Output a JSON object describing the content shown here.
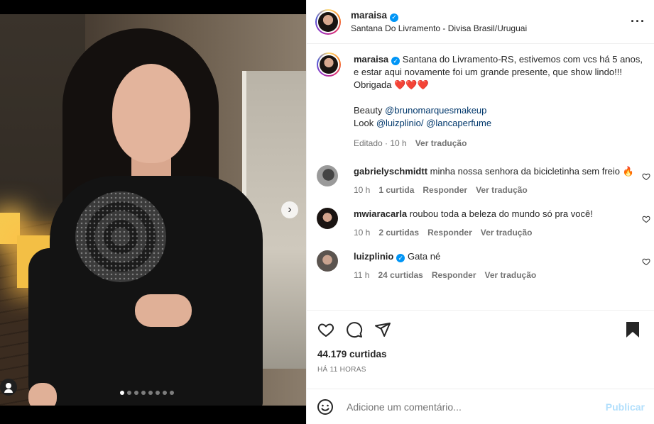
{
  "post": {
    "author": "maraisa",
    "location": "Santana Do Livramento - Divisa Brasil/Uruguai",
    "verified": true
  },
  "media": {
    "slide_count": 8,
    "active_slide": 1,
    "next_icon": "chevron-right-icon",
    "tag_icon": "person-tag-icon"
  },
  "caption": {
    "user": "maraisa",
    "text1": "Santana do Livramento-RS, estivemos com vcs há 5 anos, e estar aqui novamente foi um grande presente, que show lindo!!! Obrigada",
    "hearts": "❤️❤️❤️",
    "beauty_label": "Beauty",
    "beauty_handle": "@brunomarquesmakeup",
    "look_label": "Look",
    "look_handle1": "@luizplinio/",
    "look_handle2": "@lancaperfume",
    "edited": "Editado · 10 h",
    "translate": "Ver tradução"
  },
  "comments": [
    {
      "user": "gabrielyschmidtt",
      "text": "minha nossa senhora da bicicletinha sem freio",
      "emoji": "🔥",
      "time": "10 h",
      "likes": "1 curtida",
      "reply": "Responder",
      "translate": "Ver tradução"
    },
    {
      "user": "mwiaracarla",
      "text": "roubou toda a beleza do mundo só pra você!",
      "time": "10 h",
      "likes": "2 curtidas",
      "reply": "Responder",
      "translate": "Ver tradução"
    },
    {
      "user": "luizplinio",
      "verified": true,
      "text": "Gata né",
      "time": "11 h",
      "likes": "24 curtidas",
      "reply": "Responder",
      "translate": "Ver tradução"
    }
  ],
  "actions": {
    "likes": "44.179 curtidas",
    "time_ago": "HÁ 11 HORAS"
  },
  "add_comment": {
    "placeholder": "Adicione um comentário...",
    "publish": "Publicar"
  },
  "colors": {
    "verified": "#0095f6",
    "link": "#00376b",
    "publish_disabled": "#b2dffc",
    "heart": "#ed4956"
  }
}
